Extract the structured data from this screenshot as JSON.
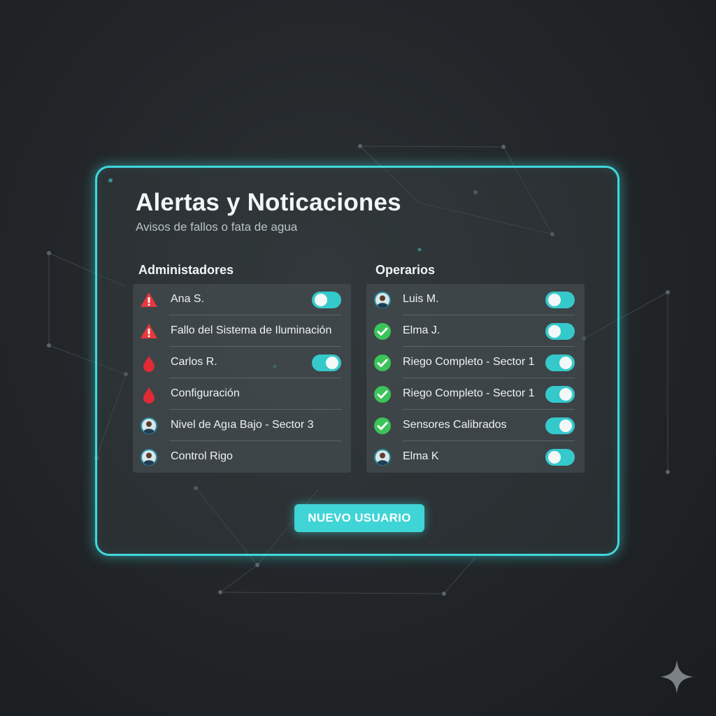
{
  "panel": {
    "title": "Alertas y Noticaciones",
    "subtitle": "Avisos de fallos o fata de agua"
  },
  "admins": {
    "heading": "Administadores",
    "items": [
      {
        "label": "Ana S.",
        "icon": "warning-icon",
        "toggle": "on"
      },
      {
        "label": "Fallo del Sistema de Iluminación",
        "icon": "warning-icon",
        "toggle": null
      },
      {
        "label": "Carlos R.",
        "icon": "water-drop-icon",
        "toggle": "on"
      },
      {
        "label": "Configuración",
        "icon": "water-drop-icon",
        "toggle": null
      },
      {
        "label": "Nivel de Agıa Bajo - Sector 3",
        "icon": "avatar-icon",
        "toggle": null
      },
      {
        "label": "Control Rigo",
        "icon": "avatar-icon",
        "toggle": null
      }
    ]
  },
  "operators": {
    "heading": "Operarios",
    "items": [
      {
        "label": "Luis M.",
        "icon": "avatar-icon",
        "toggle": "on"
      },
      {
        "label": "Elma J.",
        "icon": "check-circle-icon",
        "toggle": "on"
      },
      {
        "label": "Riego Completo - Sector 1",
        "icon": "check-circle-icon",
        "toggle": "on"
      },
      {
        "label": "Riego Completo - Sector 1",
        "icon": "check-circle-icon",
        "toggle": "on"
      },
      {
        "label": "Sensores Calibrados",
        "icon": "check-circle-icon",
        "toggle": "on"
      },
      {
        "label": "Elma K",
        "icon": "avatar-icon",
        "toggle": "on"
      }
    ]
  },
  "actions": {
    "new_user_label": "NUEVO USUARIO"
  },
  "colors": {
    "accent": "#3fd8dc",
    "warning": "#e8383d",
    "water": "#e02a35",
    "success": "#3cc35a"
  }
}
